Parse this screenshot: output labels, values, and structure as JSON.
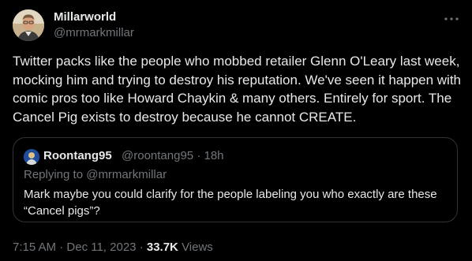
{
  "author": {
    "name": "Millarworld",
    "handle": "@mrmarkmillar"
  },
  "tweet": {
    "text": "Twitter packs like the people who mobbed retailer Glenn O'Leary last week, mocking him and trying to destroy his reputation. We've seen it happen with comic pros too like Howard Chaykin & many others. Entirely for sport. The Cancel Pig exists to destroy because he cannot CREATE."
  },
  "quoted": {
    "name": "Roontang95",
    "handle": "@roontang95",
    "separator": "·",
    "age": "18h",
    "replying_to": "Replying to @mrmarkmillar",
    "text": "Mark maybe you could clarify for the people labeling you who exactly are these “Cancel pigs”?"
  },
  "meta": {
    "time": "7:15 AM",
    "dot": "·",
    "date": "Dec 11, 2023",
    "views_count": "33.7K",
    "views_label": "Views"
  },
  "icons": {
    "more": "more-horizontal-icon"
  },
  "colors": {
    "background": "#000000",
    "primary_text": "#e7e9ea",
    "secondary_text": "#71767b",
    "border": "#2f3336"
  }
}
